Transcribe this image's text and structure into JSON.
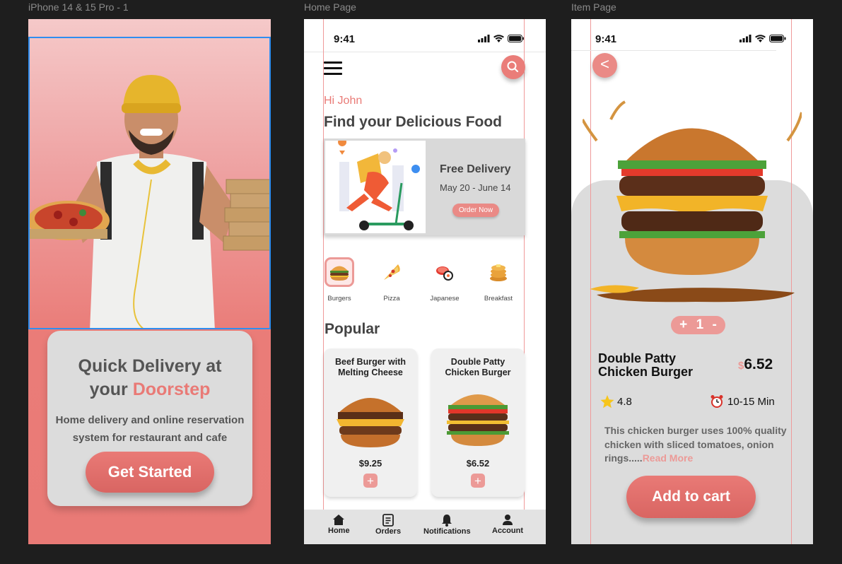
{
  "frames": {
    "f1": "iPhone 14 & 15 Pro - 1",
    "f2": "Home Page",
    "f3": "Item Page"
  },
  "status_time": "9:41",
  "onboarding": {
    "title_line1": "Quick Delivery at",
    "title_line2": "your ",
    "title_accent": "Doorstep",
    "subtitle": "Home delivery and online reservation system for restaurant and cafe",
    "cta": "Get Started"
  },
  "home": {
    "greeting": "Hi John",
    "heading": "Find your Delicious Food",
    "promo": {
      "title": "Free Delivery",
      "dates": "May 20 - June 14",
      "cta": "Order Now"
    },
    "categories": [
      {
        "label": "Burgers",
        "icon": "burger-icon",
        "selected": true
      },
      {
        "label": "Pizza",
        "icon": "pizza-icon"
      },
      {
        "label": "Japanese",
        "icon": "sushi-icon"
      },
      {
        "label": "Breakfast",
        "icon": "pancakes-icon"
      }
    ],
    "popular_heading": "Popular",
    "popular": [
      {
        "name": "Beef Burger with Melting Cheese",
        "price": "$9.25",
        "add": "+"
      },
      {
        "name": "Double Patty Chicken Burger",
        "price": "$6.52",
        "add": "+"
      }
    ],
    "tabs": [
      {
        "label": "Home",
        "icon": "home-icon"
      },
      {
        "label": "Orders",
        "icon": "orders-icon"
      },
      {
        "label": "Notifications",
        "icon": "bell-icon"
      },
      {
        "label": "Account",
        "icon": "user-icon"
      }
    ]
  },
  "item": {
    "back": "<",
    "qty_plus": "+",
    "qty_value": "1",
    "qty_minus": "-",
    "name": "Double Patty Chicken Burger",
    "currency": "$",
    "price": "6.52",
    "rating": "4.8",
    "eta": "10-15 Min",
    "description": "This chicken burger uses 100% quality chicken with sliced tomatoes, onion rings.....",
    "read_more": "Read More",
    "cta": "Add to cart"
  },
  "colors": {
    "accent": "#e97a76",
    "accent_light": "#ec9a97",
    "card_grey": "#dcdcdc"
  }
}
